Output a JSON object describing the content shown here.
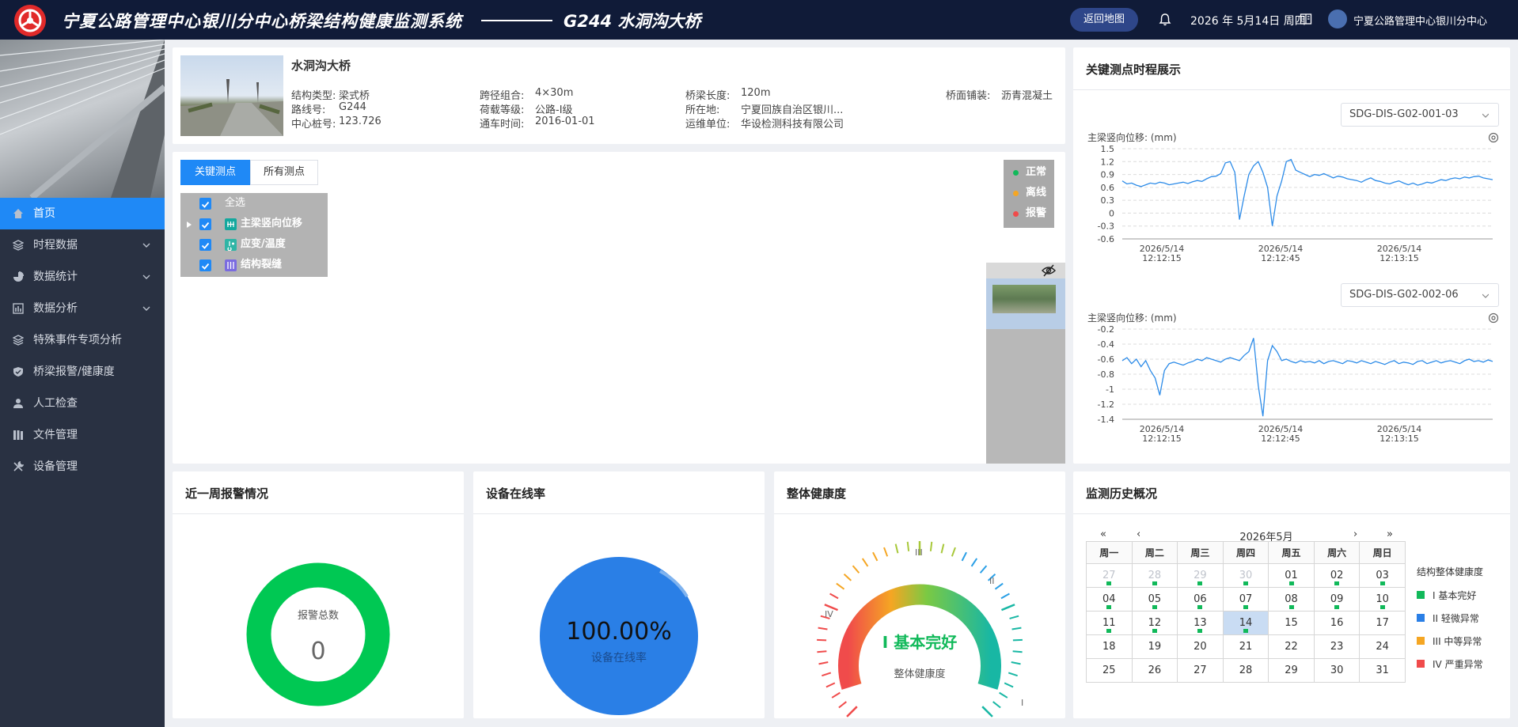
{
  "header": {
    "system_title": "宁夏公路管理中心银川分中心桥梁结构健康监测系统",
    "bridge_title": "G244  水洞沟大桥",
    "back_button": "返回地图",
    "date": "2026 年 5月14日 周四",
    "org_name": "宁夏公路管理中心银川分中心"
  },
  "sidebar": {
    "items": [
      {
        "label": "首页",
        "icon": "home-icon",
        "active": true,
        "expandable": false
      },
      {
        "label": "时程数据",
        "icon": "layers-icon",
        "active": false,
        "expandable": true
      },
      {
        "label": "数据统计",
        "icon": "pie-chart-icon",
        "active": false,
        "expandable": true
      },
      {
        "label": "数据分析",
        "icon": "bar-chart-icon",
        "active": false,
        "expandable": true
      },
      {
        "label": "特殊事件专项分析",
        "icon": "layers-icon",
        "active": false,
        "expandable": false
      },
      {
        "label": "桥梁报警/健康度",
        "icon": "shield-icon",
        "active": false,
        "expandable": false
      },
      {
        "label": "人工检查",
        "icon": "user-icon",
        "active": false,
        "expandable": false
      },
      {
        "label": "文件管理",
        "icon": "files-icon",
        "active": false,
        "expandable": false
      },
      {
        "label": "设备管理",
        "icon": "tools-icon",
        "active": false,
        "expandable": false
      }
    ]
  },
  "bridge_info": {
    "name": "水洞沟大桥",
    "fields": [
      {
        "label": "结构类型:",
        "value": "梁式桥"
      },
      {
        "label": "跨径组合:",
        "value": "4×30m"
      },
      {
        "label": "桥梁长度:",
        "value": "120m"
      },
      {
        "label": "桥面铺装:",
        "value": "沥青混凝土"
      },
      {
        "label": "路线号:",
        "value": "G244"
      },
      {
        "label": "荷载等级:",
        "value": "公路-I级"
      },
      {
        "label": "所在地:",
        "value": "宁夏回族自治区银川..."
      },
      {
        "label": "中心桩号:",
        "value": "123.726"
      },
      {
        "label": "通车时间:",
        "value": "2016-01-01"
      },
      {
        "label": "运维单位:",
        "value": "华设检测科技有限公司"
      }
    ]
  },
  "monitor_panel": {
    "tabs": [
      "关键测点",
      "所有测点"
    ],
    "tree": [
      "全选",
      "主梁竖向位移",
      "应变/温度",
      "结构裂缝"
    ],
    "legend": [
      {
        "label": "正常",
        "color": "#11b95a"
      },
      {
        "label": "离线",
        "color": "#f5a623"
      },
      {
        "label": "报警",
        "color": "#f04b4b"
      }
    ]
  },
  "timeseries": {
    "title": "关键测点时程展示",
    "charts": [
      {
        "sensor": "SDG-DIS-G02-001-03",
        "ylabel": "主梁竖向位移: (mm)"
      },
      {
        "sensor": "SDG-DIS-G02-002-06",
        "ylabel": "主梁竖向位移: (mm)"
      }
    ]
  },
  "chart_data": [
    {
      "type": "line",
      "title": "",
      "ylabel": "主梁竖向位移: (mm)",
      "xlabel": "",
      "ylim": [
        -0.6,
        1.5
      ],
      "yticks": [
        "1.5",
        "1.2",
        "0.9",
        "0.6",
        "0.3",
        "0",
        "-0.3",
        "-0.6"
      ],
      "xticks": [
        "2026/5/14 12:12:15",
        "2026/5/14 12:12:45",
        "2026/5/14 12:13:15"
      ],
      "series": [
        {
          "values": [
            0.75,
            0.68,
            0.7,
            0.65,
            0.62,
            0.66,
            0.7,
            0.68,
            0.72,
            0.7,
            0.66,
            0.68,
            0.7,
            0.72,
            0.69,
            0.73,
            0.76,
            0.74,
            0.8,
            0.85,
            0.86,
            0.92,
            1.17,
            1.2,
            0.95,
            -0.15,
            0.4,
            0.9,
            1.1,
            1.2,
            0.95,
            0.6,
            -0.3,
            0.4,
            0.75,
            1.2,
            1.25,
            1.0,
            0.95,
            0.9,
            0.85,
            0.9,
            0.88,
            0.92,
            0.87,
            0.82,
            0.86,
            0.84,
            0.8,
            0.78,
            0.76,
            0.72,
            0.78,
            0.82,
            0.76,
            0.74,
            0.7,
            0.68,
            0.72,
            0.75,
            0.7,
            0.66,
            0.7,
            0.65,
            0.68,
            0.72,
            0.7,
            0.74,
            0.78,
            0.76,
            0.8,
            0.82,
            0.8,
            0.84,
            0.82,
            0.85,
            0.86,
            0.82,
            0.8,
            0.78
          ]
        }
      ]
    },
    {
      "type": "line",
      "title": "",
      "ylabel": "主梁竖向位移: (mm)",
      "xlabel": "",
      "ylim": [
        -1.4,
        -0.2
      ],
      "yticks": [
        "-0.2",
        "-0.4",
        "-0.6",
        "-0.8",
        "-1",
        "-1.2",
        "-1.4"
      ],
      "xticks": [
        "2026/5/14 12:12:15",
        "2026/5/14 12:12:45",
        "2026/5/14 12:13:15"
      ],
      "series": [
        {
          "values": [
            -0.62,
            -0.58,
            -0.66,
            -0.6,
            -0.7,
            -0.62,
            -0.75,
            -0.85,
            -1.08,
            -0.75,
            -0.66,
            -0.64,
            -0.66,
            -0.68,
            -0.65,
            -0.63,
            -0.6,
            -0.62,
            -0.58,
            -0.6,
            -0.62,
            -0.64,
            -0.6,
            -0.58,
            -0.6,
            -0.62,
            -0.55,
            -0.5,
            -0.32,
            -0.95,
            -1.36,
            -0.62,
            -0.42,
            -0.5,
            -0.62,
            -0.6,
            -0.63,
            -0.65,
            -0.62,
            -0.64,
            -0.63,
            -0.65,
            -0.62,
            -0.66,
            -0.63,
            -0.62,
            -0.64,
            -0.66,
            -0.62,
            -0.63,
            -0.65,
            -0.62,
            -0.64,
            -0.66,
            -0.63,
            -0.65,
            -0.67,
            -0.64,
            -0.62,
            -0.66,
            -0.64,
            -0.65,
            -0.67,
            -0.63,
            -0.62,
            -0.66,
            -0.64,
            -0.62,
            -0.65,
            -0.63,
            -0.62,
            -0.64,
            -0.66,
            -0.62,
            -0.6,
            -0.63,
            -0.62,
            -0.64,
            -0.61,
            -0.63
          ]
        }
      ]
    },
    {
      "type": "pie",
      "title": "近一周报警情况",
      "center_label": "报警总数",
      "center_value": "0",
      "slices": [
        {
          "value": 0
        }
      ],
      "color": "#00c853"
    },
    {
      "type": "pie",
      "title": "设备在线率",
      "center_value": "100.00%",
      "center_label": "设备在线率",
      "slices": [
        {
          "value": 100
        }
      ],
      "color": "#2a7fe6"
    },
    {
      "type": "gauge",
      "title": "整体健康度",
      "value_label": "I 基本完好",
      "caption": "整体健康度",
      "tick_labels": [
        "IV",
        "III",
        "II",
        "I"
      ]
    }
  ],
  "alarm_card": {
    "title": "近一周报警情况",
    "center_label": "报警总数",
    "center_value": "0"
  },
  "online_card": {
    "title": "设备在线率",
    "value": "100.00%",
    "label": "设备在线率"
  },
  "health_card": {
    "title": "整体健康度",
    "value": "I 基本完好",
    "caption": "整体健康度",
    "ticks": [
      "IV",
      "III",
      "II",
      "I"
    ]
  },
  "history": {
    "title": "监测历史概况",
    "month": "2026年5月",
    "nav": [
      "«",
      "‹",
      "›",
      "»"
    ],
    "weekdays": [
      "周一",
      "周二",
      "周三",
      "周四",
      "周五",
      "周六",
      "周日"
    ],
    "weeks": [
      [
        {
          "d": "27",
          "muted": true,
          "mk": true
        },
        {
          "d": "28",
          "muted": true,
          "mk": true
        },
        {
          "d": "29",
          "muted": true,
          "mk": true
        },
        {
          "d": "30",
          "muted": true,
          "mk": true
        },
        {
          "d": "01",
          "mk": true
        },
        {
          "d": "02",
          "mk": true
        },
        {
          "d": "03",
          "mk": true
        }
      ],
      [
        {
          "d": "04",
          "mk": true
        },
        {
          "d": "05",
          "mk": true
        },
        {
          "d": "06",
          "mk": true
        },
        {
          "d": "07",
          "mk": true
        },
        {
          "d": "08",
          "mk": true
        },
        {
          "d": "09",
          "mk": true
        },
        {
          "d": "10",
          "mk": true
        }
      ],
      [
        {
          "d": "11",
          "mk": true
        },
        {
          "d": "12",
          "mk": true
        },
        {
          "d": "13",
          "mk": true
        },
        {
          "d": "14",
          "mk": true,
          "today": true
        },
        {
          "d": "15"
        },
        {
          "d": "16"
        },
        {
          "d": "17"
        }
      ],
      [
        {
          "d": "18"
        },
        {
          "d": "19"
        },
        {
          "d": "20"
        },
        {
          "d": "21"
        },
        {
          "d": "22"
        },
        {
          "d": "23"
        },
        {
          "d": "24"
        }
      ],
      [
        {
          "d": "25"
        },
        {
          "d": "26"
        },
        {
          "d": "27"
        },
        {
          "d": "28"
        },
        {
          "d": "29"
        },
        {
          "d": "30"
        },
        {
          "d": "31"
        }
      ]
    ],
    "legend_title": "结构整体健康度",
    "legend": [
      {
        "label": "I 基本完好",
        "color": "#11b95a"
      },
      {
        "label": "II 轻微异常",
        "color": "#2a7fe6"
      },
      {
        "label": "III 中等异常",
        "color": "#f5a623"
      },
      {
        "label": "IV 严重异常",
        "color": "#f04b4b"
      }
    ]
  },
  "colors": {
    "accent": "#1f89f6",
    "header_bg": "#101b38",
    "sidebar_bg": "#293142"
  }
}
